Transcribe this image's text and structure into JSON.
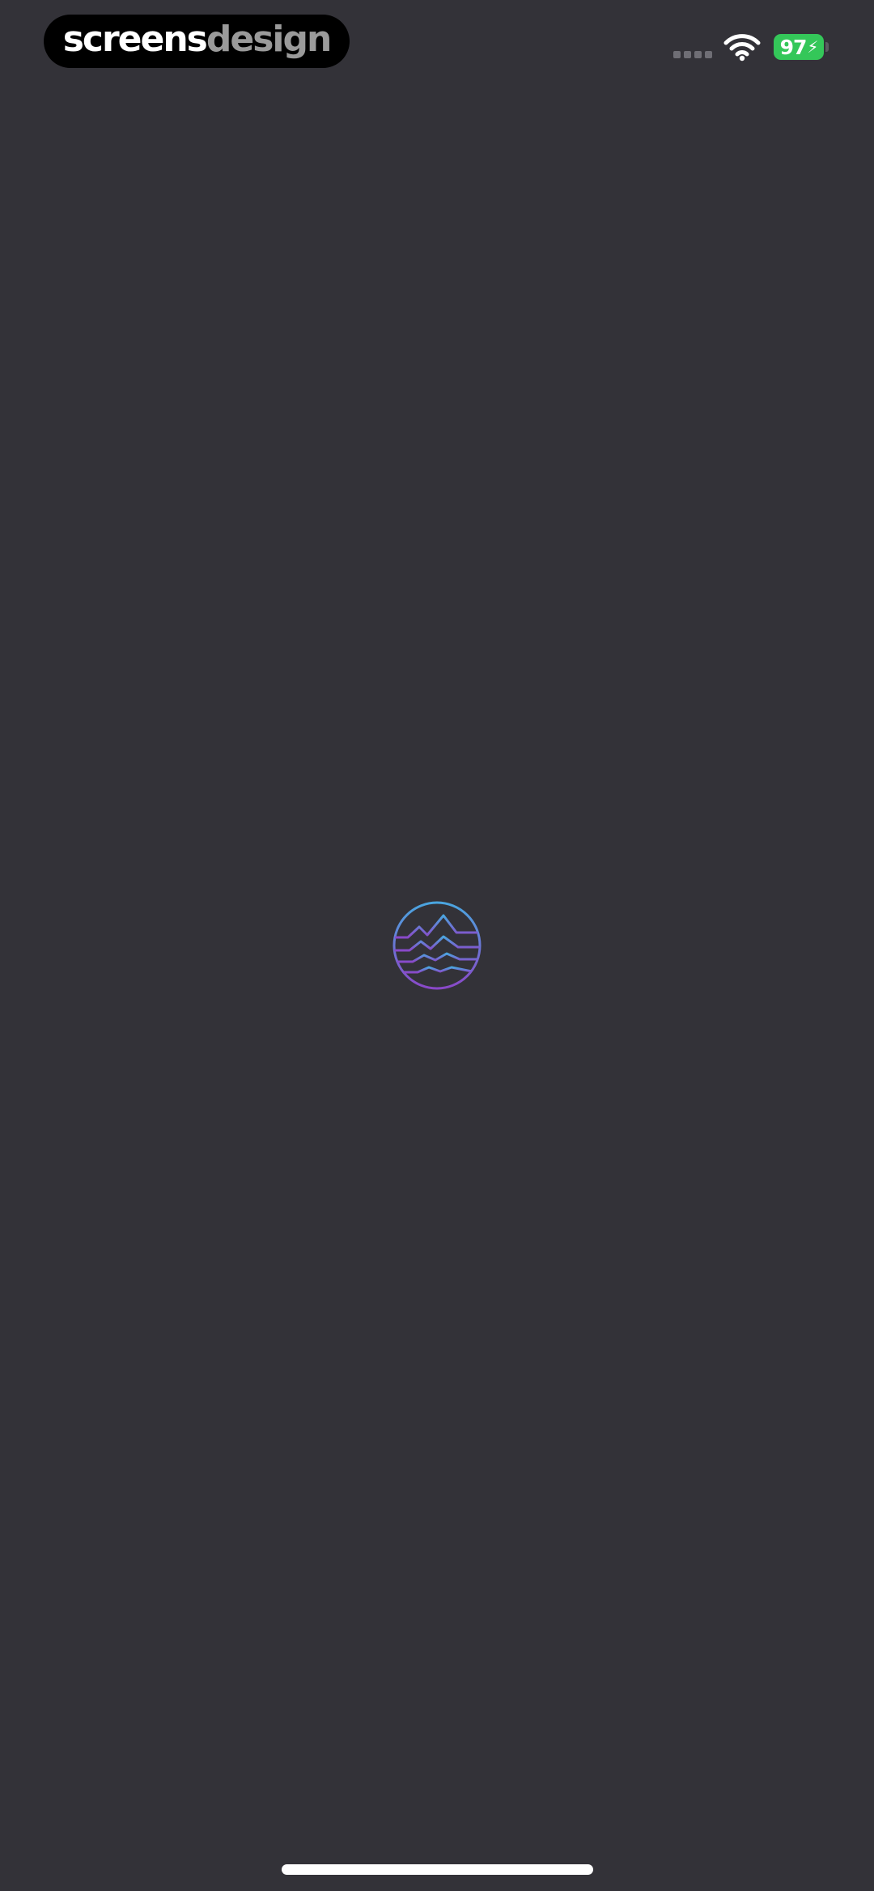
{
  "status_bar": {
    "brand_part1": "screens",
    "brand_part2": "design",
    "battery_level": "97",
    "battery_bolt": "⚡",
    "wifi_icon": "wifi-icon",
    "signal_icon": "signal-dots-icon"
  },
  "main": {
    "logo_icon": "mountain-waves-circle-icon"
  },
  "colors": {
    "background": "#333238",
    "battery": "#34c759",
    "logo_gradient_top": "#4aa6e0",
    "logo_gradient_bottom": "#8a48c8"
  }
}
